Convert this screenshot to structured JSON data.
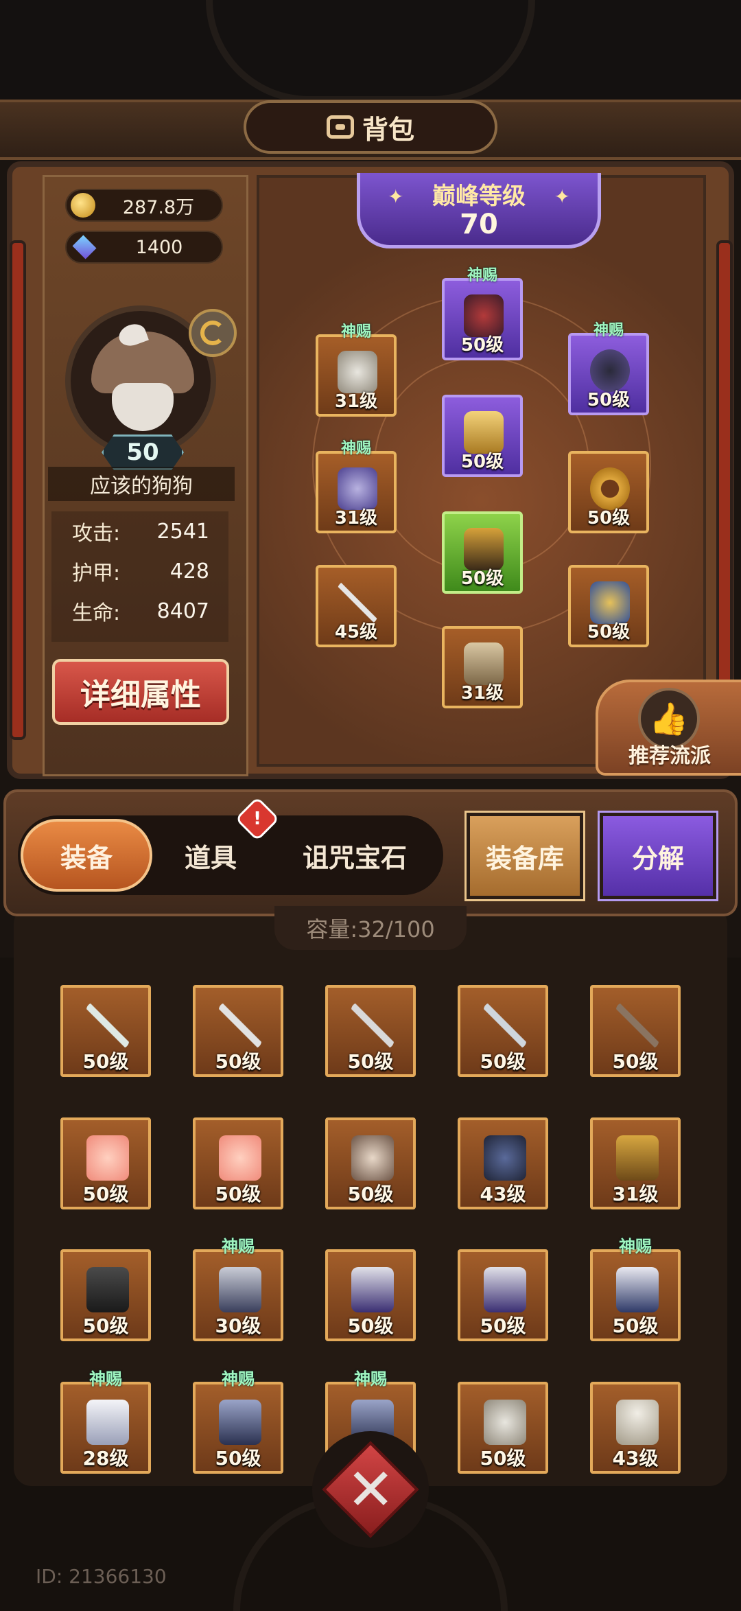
{
  "title": "背包",
  "currency": {
    "gold": "287.8万",
    "gems": "1400"
  },
  "player": {
    "level": "50",
    "name": "应该的狗狗",
    "stats": [
      {
        "label": "攻击:",
        "value": "2541"
      },
      {
        "label": "护甲:",
        "value": "428"
      },
      {
        "label": "生命:",
        "value": "8407"
      }
    ],
    "detail_button": "详细属性"
  },
  "peak": {
    "label": "巅峰等级",
    "value": "70"
  },
  "equipped": {
    "helmet": {
      "level": "50级",
      "badge": "神赐"
    },
    "necklace": {
      "level": "50级",
      "badge": "神赐"
    },
    "shoulder": {
      "level": "31级",
      "badge": "神赐"
    },
    "armor": {
      "level": "50级"
    },
    "gloves": {
      "level": "31级",
      "badge": "神赐"
    },
    "ring": {
      "level": "50级"
    },
    "belt": {
      "level": "50级"
    },
    "weapon": {
      "level": "45级"
    },
    "trinket": {
      "level": "50级"
    },
    "boots": {
      "level": "31级"
    }
  },
  "recommend_label": "推荐流派",
  "tabs": {
    "equipment": "装备",
    "items": "道具",
    "curse_gems": "诅咒宝石",
    "alert": "!"
  },
  "buttons": {
    "storage": "装备库",
    "decompose": "分解"
  },
  "capacity": "容量:32/100",
  "inventory": [
    {
      "level": "50级",
      "badge": ""
    },
    {
      "level": "50级",
      "badge": ""
    },
    {
      "level": "50级",
      "badge": ""
    },
    {
      "level": "50级",
      "badge": ""
    },
    {
      "level": "50级",
      "badge": ""
    },
    {
      "level": "50级",
      "badge": ""
    },
    {
      "level": "50级",
      "badge": ""
    },
    {
      "level": "50级",
      "badge": ""
    },
    {
      "level": "43级",
      "badge": ""
    },
    {
      "level": "31级",
      "badge": ""
    },
    {
      "level": "50级",
      "badge": ""
    },
    {
      "level": "30级",
      "badge": "神赐"
    },
    {
      "level": "50级",
      "badge": ""
    },
    {
      "level": "50级",
      "badge": ""
    },
    {
      "level": "50级",
      "badge": "神赐"
    },
    {
      "level": "28级",
      "badge": "神赐"
    },
    {
      "level": "50级",
      "badge": "神赐"
    },
    {
      "level": "",
      "badge": "神赐"
    },
    {
      "level": "50级",
      "badge": ""
    },
    {
      "level": "43级",
      "badge": ""
    }
  ],
  "player_id": "ID: 21366130",
  "colors": {
    "frame_gold": "#e9b45f",
    "epic_purple": "#8d5ddd",
    "rare_green": "#8ed24a",
    "divine_badge": "#9ff5c0"
  }
}
